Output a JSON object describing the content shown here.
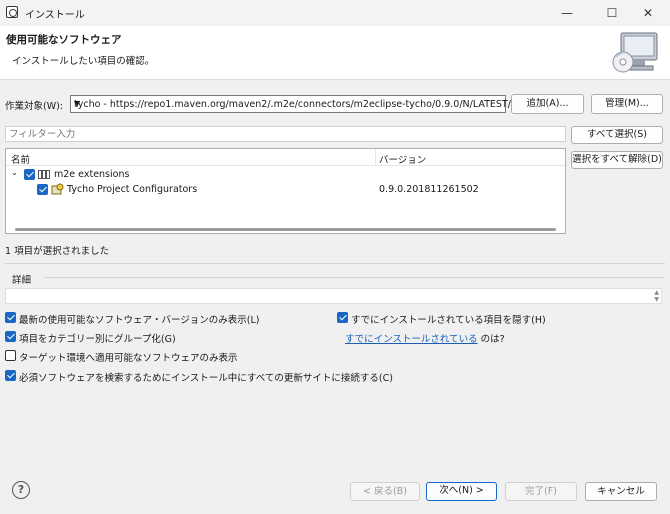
{
  "window": {
    "title": "インストール",
    "minimize_glyph": "—",
    "maximize_glyph": "☐",
    "close_glyph": "✕"
  },
  "header": {
    "title": "使用可能なソフトウェア",
    "description": "インストールしたい項目の確認。",
    "icon": "install-monitor-cd-icon"
  },
  "work_with": {
    "label": "作業対象(W):",
    "value": "tycho - https://repo1.maven.org/maven2/.m2e/connectors/m2eclipse-tycho/0.9.0/N/LATEST/",
    "add_label": "追加(A)...",
    "manage_label": "管理(M)..."
  },
  "filter": {
    "placeholder": "フィルター入力"
  },
  "side_buttons": {
    "select_all": "すべて選択(S)",
    "deselect_all": "選択をすべて解除(D)"
  },
  "tree": {
    "columns": [
      "名前",
      "バージョン"
    ],
    "category": {
      "name": "m2e extensions",
      "checked": true,
      "expanded": true
    },
    "item": {
      "name": "Tycho Project Configurators",
      "version": "0.9.0.201811261502",
      "checked": true
    }
  },
  "status": "1 項目が選択されました",
  "details": {
    "label": "詳細"
  },
  "options": {
    "latest_only": {
      "label": "最新の使用可能なソフトウェア・バージョンのみ表示(L)",
      "checked": true
    },
    "group_by_category": {
      "label": "項目をカテゴリー別にグループ化(G)",
      "checked": true
    },
    "target_env_only": {
      "label": "ターゲット環境へ適用可能なソフトウェアのみ表示",
      "checked": false
    },
    "contact_all_sites": {
      "label": "必須ソフトウェアを検索するためにインストール中にすべての更新サイトに接続する(C)",
      "checked": true
    },
    "hide_installed": {
      "label": "すでにインストールされている項目を隠す(H)",
      "checked": true
    },
    "what_installed_link": "すでにインストールされている",
    "what_installed_suffix": "のは?"
  },
  "footer": {
    "back": "< 戻る(B)",
    "next": "次へ(N) >",
    "finish": "完了(F)",
    "cancel": "キャンセル"
  }
}
